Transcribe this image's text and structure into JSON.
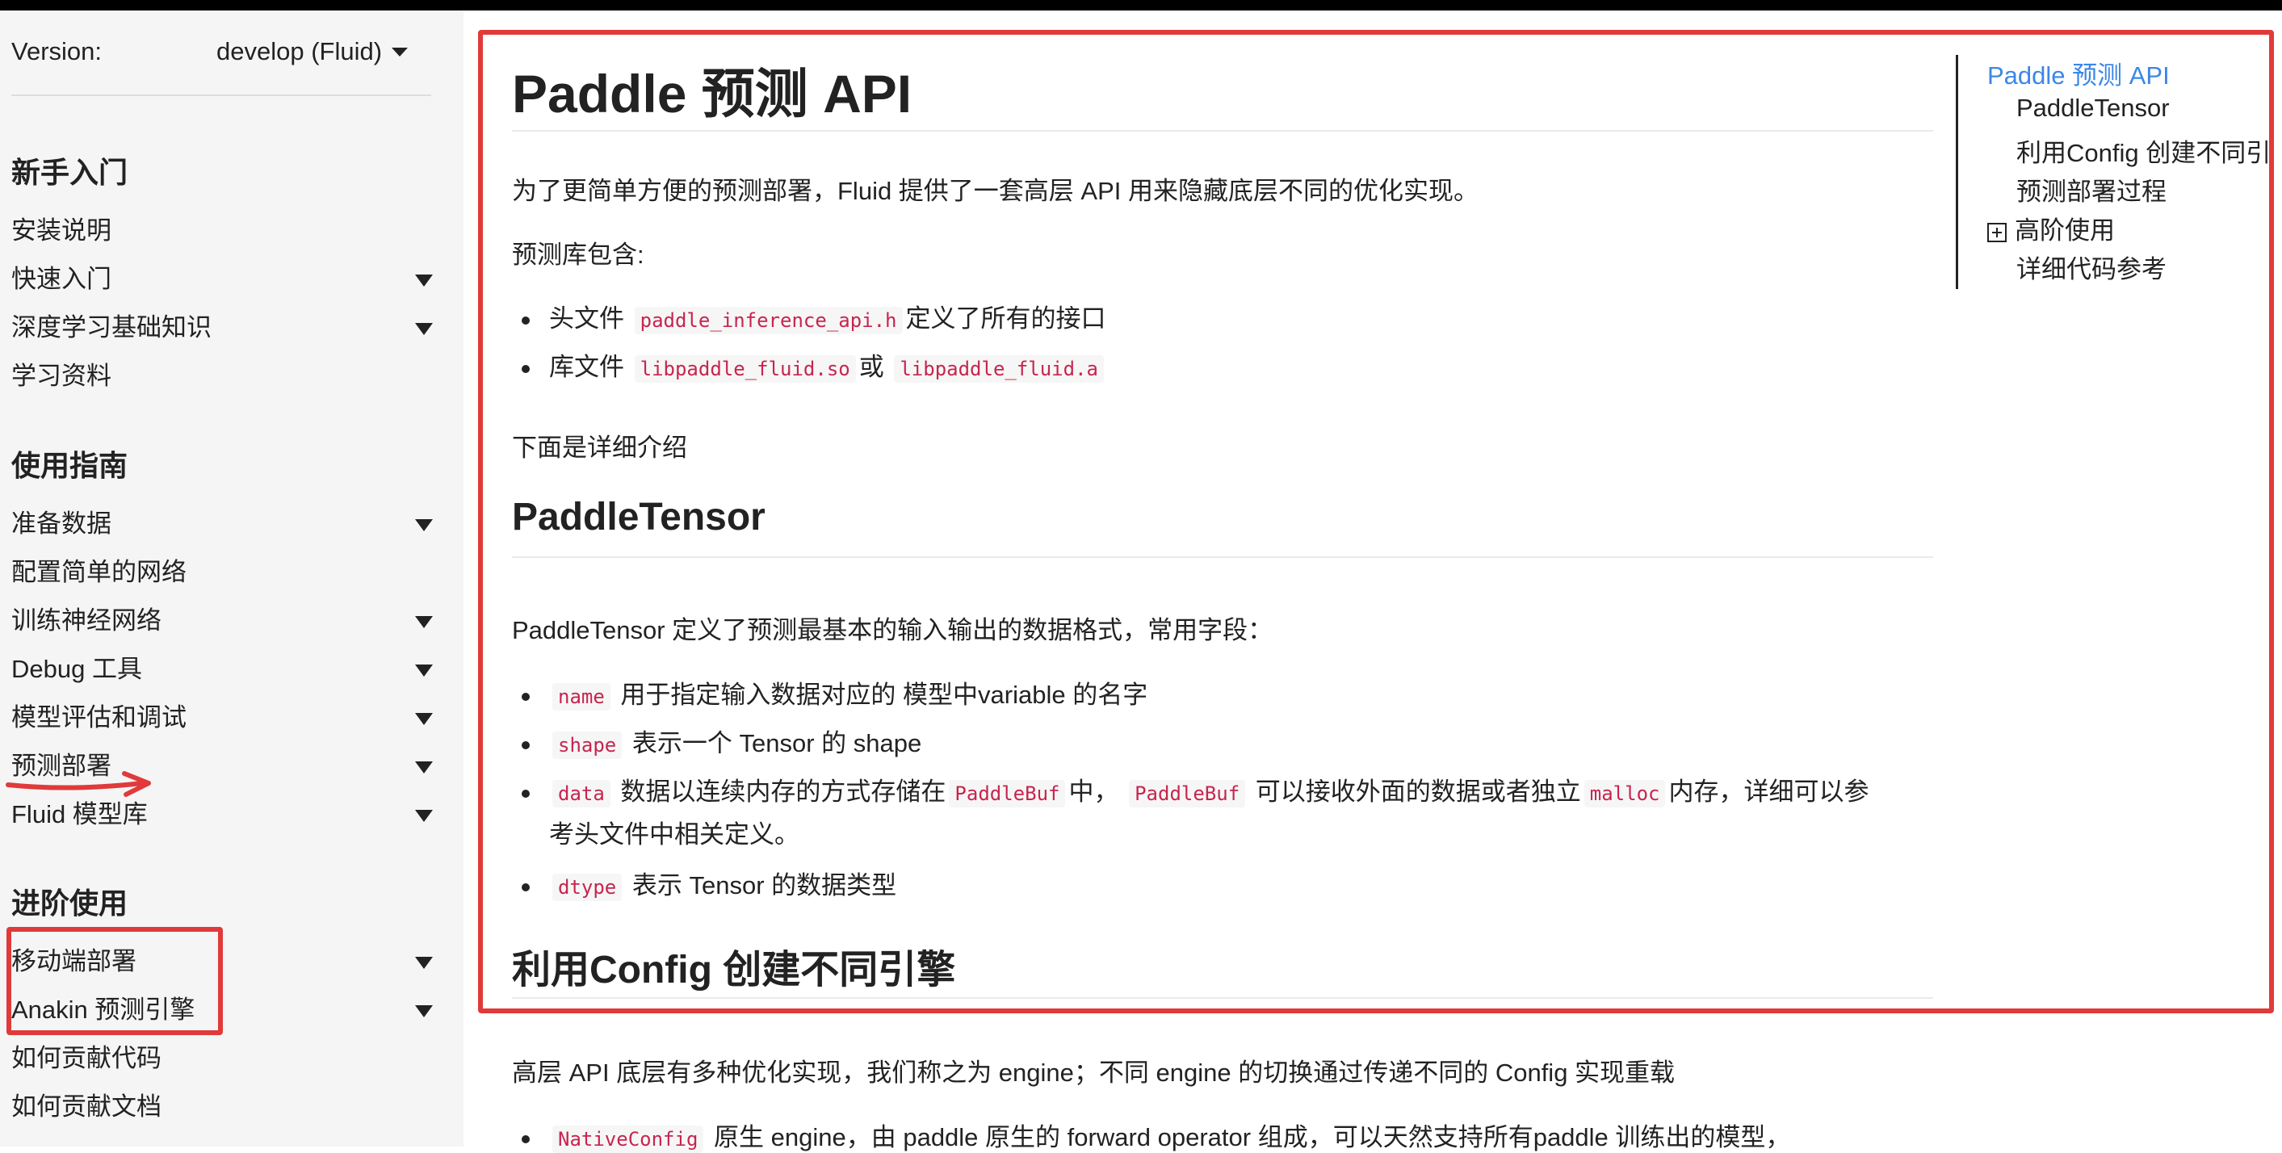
{
  "sidebar": {
    "version_label": "Version:",
    "version_value": "develop (Fluid)",
    "sections": [
      {
        "title": "新手入门",
        "items": [
          {
            "label": "安装说明",
            "expandable": false
          },
          {
            "label": "快速入门",
            "expandable": true
          },
          {
            "label": "深度学习基础知识",
            "expandable": true
          },
          {
            "label": "学习资料",
            "expandable": false
          }
        ]
      },
      {
        "title": "使用指南",
        "items": [
          {
            "label": "准备数据",
            "expandable": true
          },
          {
            "label": "配置简单的网络",
            "expandable": false
          },
          {
            "label": "训练神经网络",
            "expandable": true
          },
          {
            "label": "Debug 工具",
            "expandable": true
          },
          {
            "label": "模型评估和调试",
            "expandable": true
          },
          {
            "label": "预测部署",
            "expandable": true
          },
          {
            "label": "Fluid 模型库",
            "expandable": true
          }
        ]
      },
      {
        "title": "进阶使用",
        "items": [
          {
            "label": "移动端部署",
            "expandable": true
          },
          {
            "label": "Anakin 预测引擎",
            "expandable": true
          },
          {
            "label": "如何贡献代码",
            "expandable": false
          },
          {
            "label": "如何贡献文档",
            "expandable": false
          }
        ]
      }
    ]
  },
  "main": {
    "title": "Paddle 预测 API",
    "intro": "为了更简单方便的预测部署，Fluid 提供了一套高层 API 用来隐藏底层不同的优化实现。",
    "lib_intro": "预测库包含:",
    "lib_items": [
      {
        "pre": "头文件",
        "code1": "paddle_inference_api.h",
        "mid": "定义了所有的接口",
        "code2": "",
        "post": ""
      },
      {
        "pre": "库文件",
        "code1": "libpaddle_fluid.so",
        "mid": "或",
        "code2": "libpaddle_fluid.a",
        "post": ""
      }
    ],
    "detail_intro": "下面是详细介绍",
    "tensor_heading": "PaddleTensor",
    "tensor_intro": "PaddleTensor 定义了预测最基本的输入输出的数据格式，常用字段：",
    "tensor_fields": [
      {
        "code": "name",
        "text": "用于指定输入数据对应的 模型中variable 的名字"
      },
      {
        "code": "shape",
        "text": "表示一个 Tensor 的 shape"
      },
      {
        "code": "data",
        "text1": "数据以连续内存的方式存储在",
        "code2": "PaddleBuf",
        "text2": "中，",
        "code3": "PaddleBuf",
        "text3": "可以接收外面的数据或者独立",
        "code4": "malloc",
        "text4": "内存，详细可以参",
        "cont": "考头文件中相关定义。"
      },
      {
        "code": "dtype",
        "text": "表示 Tensor 的数据类型"
      }
    ],
    "config_heading": "利用Config 创建不同引擎",
    "config_intro": "高层 API 底层有多种优化实现，我们称之为 engine；不同 engine 的切换通过传递不同的 Config 实现重载",
    "config_item": {
      "code": "NativeConfig",
      "text": "原生 engine，由 paddle 原生的 forward operator 组成，可以天然支持所有paddle 训练出的模型，"
    }
  },
  "toc": {
    "items": [
      {
        "label": "Paddle 预测 API",
        "active": true
      },
      {
        "label": "PaddleTensor"
      },
      {
        "label": "利用Config 创建不同引"
      },
      {
        "label": "预测部署过程"
      },
      {
        "label": "高阶使用",
        "collapsed": true
      },
      {
        "label": "详细代码参考"
      }
    ]
  },
  "colors": {
    "link_active": "#3c87e6",
    "code_text": "#c7254e",
    "annotation": "#e03a3a",
    "sidebar_bg": "#f5f5f5"
  }
}
